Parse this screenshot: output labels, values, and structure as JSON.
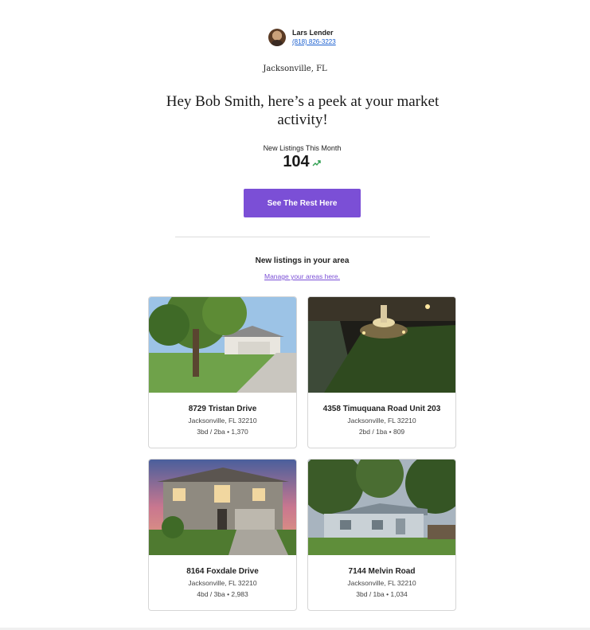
{
  "sender": {
    "name": "Lars Lender",
    "phone": "(818) 826-3223"
  },
  "location": "Jacksonville, FL",
  "headline": "Hey Bob Smith, here’s a peek at your market activity!",
  "stat": {
    "label": "New Listings This Month",
    "value": "104",
    "trend_icon": "trending-up-icon",
    "trend_color": "#2e9e4f"
  },
  "cta": {
    "label": "See The Rest Here",
    "color": "#7b4fd6"
  },
  "listings_section": {
    "title": "New listings in your area",
    "manage_link": "Manage your areas here."
  },
  "listings": [
    {
      "address": "8729 Tristan Drive",
      "city": "Jacksonville, FL 32210",
      "specs": "3bd / 2ba • 1,370"
    },
    {
      "address": "4358 Timuquana Road Unit 203",
      "city": "Jacksonville, FL 32210",
      "specs": "2bd / 1ba • 809"
    },
    {
      "address": "8164 Foxdale Drive",
      "city": "Jacksonville, FL 32210",
      "specs": "4bd / 3ba • 2,983"
    },
    {
      "address": "7144 Melvin Road",
      "city": "Jacksonville, FL 32210",
      "specs": "3bd / 1ba • 1,034"
    }
  ]
}
